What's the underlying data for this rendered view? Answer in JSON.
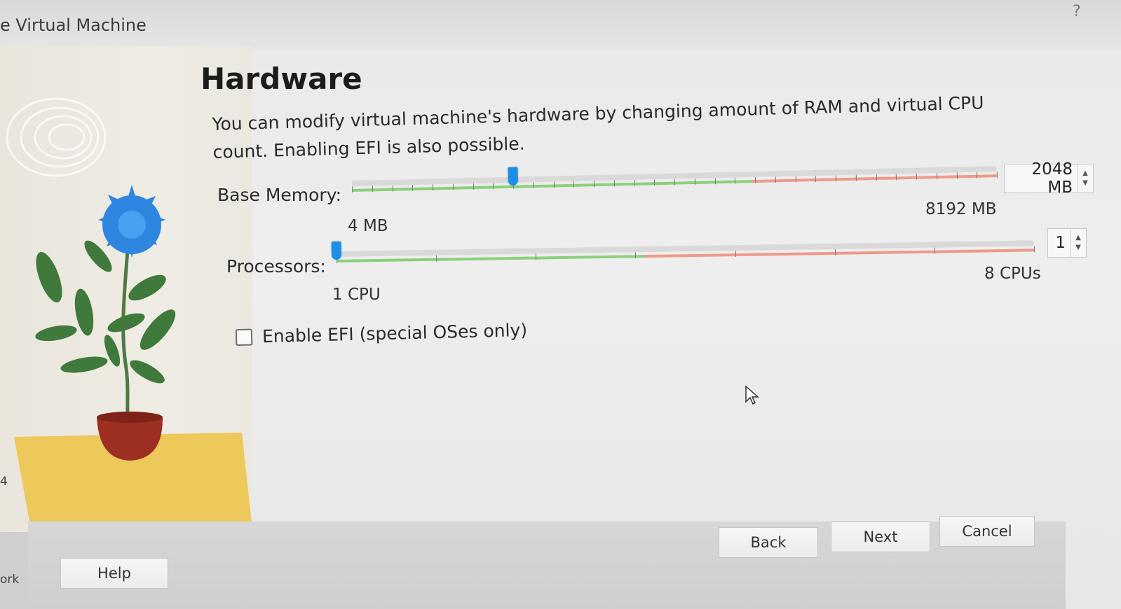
{
  "window": {
    "title": "e Virtual Machine",
    "help_glyph": "?"
  },
  "page": {
    "title": "Hardware",
    "description": "You can modify virtual machine's hardware by changing amount of RAM and virtual CPU count. Enabling EFI is also possible."
  },
  "memory": {
    "label": "Base Memory:",
    "value": "2048 MB",
    "min_label": "4 MB",
    "max_label": "8192 MB",
    "position_fraction": 0.25
  },
  "processors": {
    "label": "Processors:",
    "value": "1",
    "min_label": "1 CPU",
    "max_label": "8 CPUs",
    "position_fraction": 0.0
  },
  "efi": {
    "label": "Enable EFI (special OSes only)",
    "checked": false
  },
  "buttons": {
    "back": "Back",
    "next": "Next",
    "cancel": "Cancel",
    "help": "Help"
  },
  "left_edge": {
    "number": "4",
    "text": "ork"
  },
  "colors": {
    "handle": "#1d8fe8",
    "ok_range": "#8bd07c",
    "warn_range": "#ee9a8a",
    "pot": "#9c2e22",
    "flower": "#2f86e0",
    "table": "#edc85b"
  }
}
